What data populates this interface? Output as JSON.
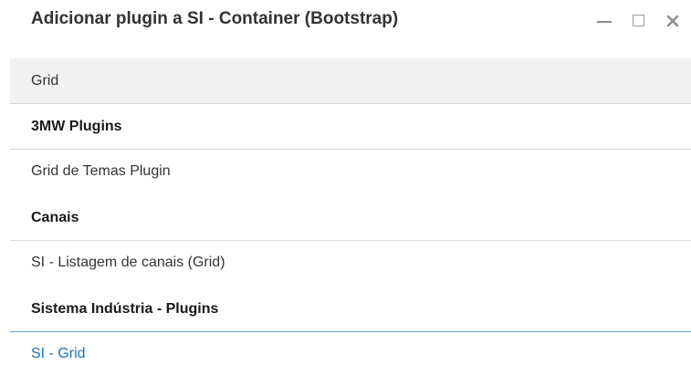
{
  "dialog": {
    "title": "Adicionar plugin a SI - Container (Bootstrap)",
    "controls": {
      "minimize_icon": "minimize-icon",
      "maximize_icon": "maximize-icon",
      "close_icon": "close-icon"
    }
  },
  "search": {
    "value": "Grid"
  },
  "groups": [
    {
      "header": "3MW Plugins",
      "items": [
        "Grid de Temas Plugin"
      ]
    },
    {
      "header": "Canais",
      "items": [
        "SI - Listagem de canais (Grid)"
      ]
    },
    {
      "header": "Sistema Indústria - Plugins",
      "items": [
        "SI - Grid"
      ]
    }
  ],
  "colors": {
    "link": "#1a73b8",
    "active_divider": "#5aa7dd",
    "search_bg": "#f1f1f1"
  }
}
